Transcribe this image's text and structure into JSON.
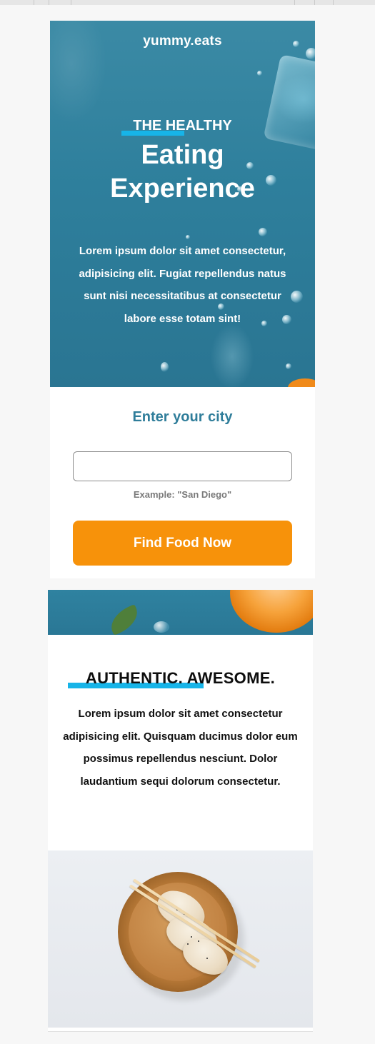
{
  "hero": {
    "brand": "yummy.eats",
    "eyebrow": "THE HEALTHY",
    "title_line1": "Eating",
    "title_line2": "Experience",
    "description": "Lorem ipsum dolor sit amet consectetur, adipisicing elit. Fugiat repellendus natus sunt nisi necessitatibus at consectetur labore esse totam sint!",
    "background_color": "#2e7f9c"
  },
  "city_form": {
    "title": "Enter your city",
    "input_value": "",
    "input_placeholder": "",
    "hint": "Example: \"San Diego\"",
    "button_label": "Find Food Now",
    "button_color": "#f7920a",
    "title_color": "#2f7d9a"
  },
  "about": {
    "title": "AUTHENTIC. AWESOME.",
    "description": "Lorem ipsum dolor sit amet consectetur adipisicing elit. Quisquam ducimus dolor eum possimus repellendus nesciunt. Dolor laudantium sequi dolorum consectetur.",
    "accent_color": "#17b4e8"
  },
  "images": {
    "hero_image": "water-drops-ice-photo",
    "strip_image": "orange-leaf-water-photo",
    "dumpling_image": "dumplings-wooden-bowl-chopsticks-photo"
  }
}
